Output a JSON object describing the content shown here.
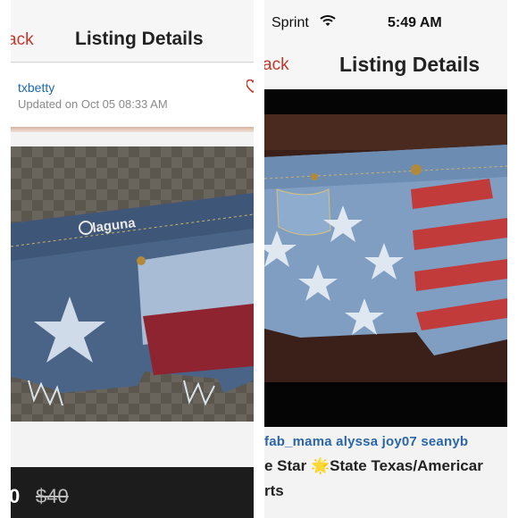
{
  "left": {
    "nav": {
      "back_label": "ack",
      "title": "Listing Details"
    },
    "seller": {
      "username": "txbetty",
      "updated": "Updated on Oct 05 08:33 AM"
    },
    "photo": {
      "brand_text": "laguna"
    },
    "price": {
      "current": "0",
      "original": "$40"
    }
  },
  "right": {
    "status_bar": {
      "carrier": "Sprint",
      "time": "5:49 AM"
    },
    "nav": {
      "back_label": "ack",
      "title": "Listing Details"
    },
    "tags": "fab_mama  alyssa  joy07  seanyb",
    "title": {
      "part1": "e Star ",
      "star_glyph": "🌟",
      "part2": "State Texas/Americar",
      "line2": "rts"
    }
  },
  "colors": {
    "accent": "#c0392b",
    "link": "#1b67b0",
    "price_bar": "#1c1c1c"
  },
  "icons": [
    "heart-icon",
    "wifi-icon",
    "star-icon"
  ]
}
